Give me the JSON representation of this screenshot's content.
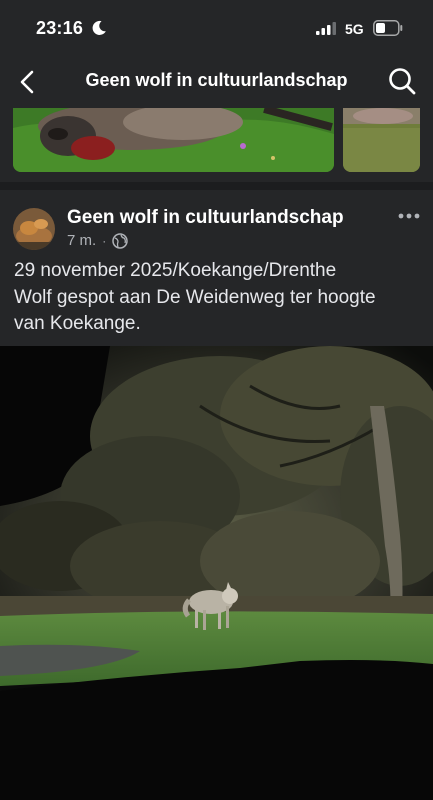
{
  "status_bar": {
    "time": "23:16",
    "network": "5G",
    "icons": [
      "moon-icon",
      "signal-icon",
      "battery-icon"
    ]
  },
  "nav": {
    "title": "Geen wolf in cultuurlandschap",
    "icons": [
      "back-chevron-icon",
      "search-icon"
    ]
  },
  "post": {
    "group_name": "Geen wolf in cultuurlandschap",
    "time_ago": "7 m.",
    "separator": "·",
    "privacy_icon": "globe-icon",
    "more_icon": "more-options-icon",
    "text_lines": [
      "29 november 2025/Koekange/Drenthe",
      "Wolf gespot aan De Weidenweg ter hoogte",
      "van Koekange."
    ]
  },
  "colors": {
    "background": "#252628",
    "divider": "#1c1d1f",
    "text_primary": "#ffffff",
    "text_secondary": "#b0b3b8"
  }
}
